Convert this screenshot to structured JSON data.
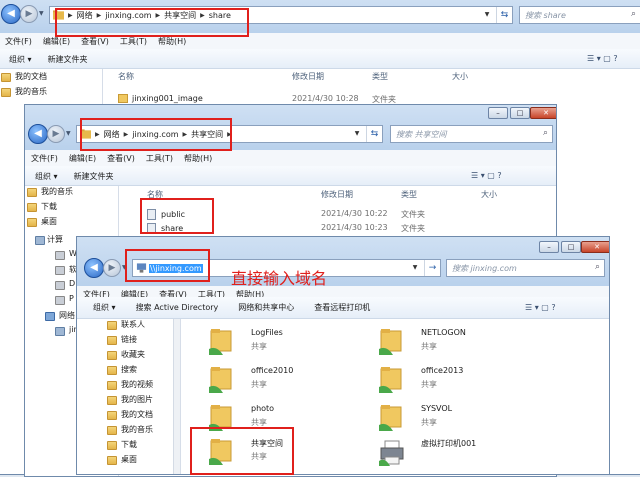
{
  "common": {
    "menu": [
      "文件(F)",
      "编辑(E)",
      "查看(V)",
      "工具(T)",
      "帮助(H)"
    ],
    "organize": "组织 ▾",
    "new_folder": "新建文件夹",
    "columns": {
      "name": "名称",
      "date": "修改日期",
      "type": "类型",
      "size": "大小"
    },
    "win_min": "–",
    "win_max": "□",
    "win_close": "✕"
  },
  "win1": {
    "crumbs": [
      "网络",
      "jinxing.com",
      "共享空间",
      "share"
    ],
    "search_placeholder": "搜索 share",
    "sidebar": [
      "我的文档",
      "我的音乐"
    ],
    "files": [
      {
        "name": "jinxing001_image",
        "date": "2021/4/30 10:28",
        "type": "文件夹"
      }
    ]
  },
  "win2": {
    "crumbs": [
      "网络",
      "jinxing.com",
      "共享空间"
    ],
    "search_placeholder": "搜索 共享空间",
    "sidebar": [
      "我的音乐",
      "下载",
      "桌面",
      "计算",
      "W",
      "软",
      "D",
      "P",
      "网络",
      "jin"
    ],
    "files": [
      {
        "name": "public",
        "date": "2021/4/30 10:22",
        "type": "文件夹"
      },
      {
        "name": "share",
        "date": "2021/4/30 10:23",
        "type": "文件夹"
      }
    ]
  },
  "win3": {
    "address": "\\\\jinxing.com",
    "search_placeholder": "搜索 jinxing.com",
    "toolbar": [
      "组织 ▾",
      "搜索 Active Directory",
      "网络和共享中心",
      "查看远程打印机"
    ],
    "sidebar": [
      "联系人",
      "链接",
      "收藏夹",
      "搜索",
      "我的视频",
      "我的图片",
      "我的文档",
      "我的音乐",
      "下载",
      "桌面"
    ],
    "items": [
      {
        "name": "LogFiles",
        "sub": "共享"
      },
      {
        "name": "NETLOGON",
        "sub": "共享"
      },
      {
        "name": "office2010",
        "sub": "共享"
      },
      {
        "name": "office2013",
        "sub": "共享"
      },
      {
        "name": "photo",
        "sub": "共享"
      },
      {
        "name": "SYSVOL",
        "sub": "共享"
      },
      {
        "name": "共享空间",
        "sub": "共享"
      },
      {
        "name": "虚拟打印机001",
        "sub": ""
      }
    ]
  },
  "annotation": "直接输入域名",
  "colors": {
    "accent_red": "#e0201c",
    "folder_yellow": "#f0c860"
  }
}
